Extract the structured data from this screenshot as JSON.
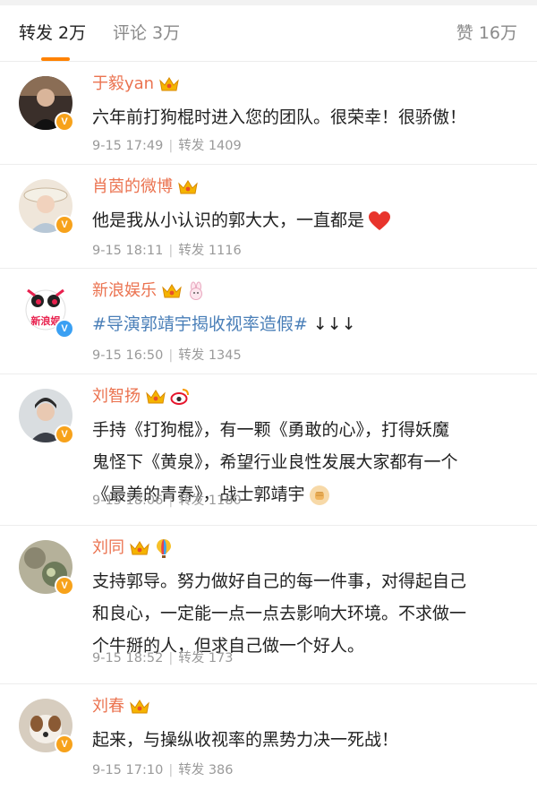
{
  "tabs": {
    "repost": "转发 2万",
    "comment": "评论 3万",
    "like": "赞 16万"
  },
  "posts": [
    {
      "name": "于毅yan",
      "lines": [
        "六年前打狗棍时进入您的团队。很荣幸！很骄傲！"
      ],
      "time": "9-15 17:49",
      "repost_label": "转发",
      "repost_count": "1409"
    },
    {
      "name": "肖茵的微博",
      "lines": [
        "他是我从小认识的郭大大，一直都是"
      ],
      "emoji": "red-heart",
      "time": "9-15 18:11",
      "repost_label": "转发",
      "repost_count": "1116"
    },
    {
      "name": "新浪娱乐",
      "hashtag": "#导演郭靖宇揭收视率造假#",
      "after_hashtag": " ↓↓↓",
      "avatar_text": "新浪娱",
      "time": "9-15 16:50",
      "repost_label": "转发",
      "repost_count": "1345"
    },
    {
      "name": "刘智扬",
      "lines": [
        "手持《打狗棍》，有一颗《勇敢的心》，打得妖魔",
        "鬼怪下《黄泉》，希望行业良性发展大家都有一个",
        "《最美的青春》，战士郭靖宇"
      ],
      "emoji": "fist",
      "time": "9-15 18:06",
      "repost_label": "转发",
      "repost_count": "1180"
    },
    {
      "name": "刘同",
      "lines": [
        "支持郭导。努力做好自己的每一件事，对得起自己",
        "和良心，一定能一点一点去影响大环境。不求做一",
        "个牛掰的人，但求自己做一个好人。"
      ],
      "time": "9-15 18:52",
      "repost_label": "转发",
      "repost_count": "173"
    },
    {
      "name": "刘春",
      "lines": [
        "起来，与操纵收视率的黑势力决一死战！"
      ],
      "time": "9-15 17:10",
      "repost_label": "转发",
      "repost_count": "386"
    }
  ],
  "badge_letter": "V",
  "colors": {
    "accent": "#ff8200",
    "username": "#eb7350",
    "hashtag": "#4a7fb8",
    "meta": "#9a9a9a"
  }
}
